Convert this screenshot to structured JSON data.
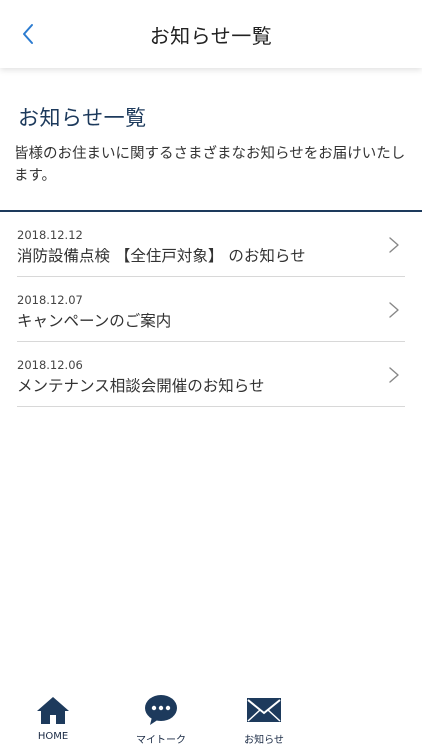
{
  "header": {
    "title": "お知らせ一覧",
    "back_icon": "chevron-left-icon"
  },
  "section": {
    "heading": "お知らせ一覧",
    "description": "皆様のお住まいに関するさまざまなお知らせをお届けいたします。"
  },
  "news": [
    {
      "date": "2018.12.12",
      "title": "消防設備点検 【全住戸対象】 のお知らせ"
    },
    {
      "date": "2018.12.07",
      "title": "キャンペーンのご案内"
    },
    {
      "date": "2018.12.06",
      "title": "メンテナンス相談会開催のお知らせ"
    }
  ],
  "tabbar": {
    "items": [
      {
        "label": "HOME",
        "icon": "home-icon"
      },
      {
        "label": "マイトーク",
        "icon": "chat-bubble-icon"
      },
      {
        "label": "お知らせ",
        "icon": "envelope-icon"
      }
    ]
  },
  "colors": {
    "accent_navy": "#1d3a5c",
    "back_blue": "#2b7bd0",
    "divider": "#d8d8d8"
  }
}
